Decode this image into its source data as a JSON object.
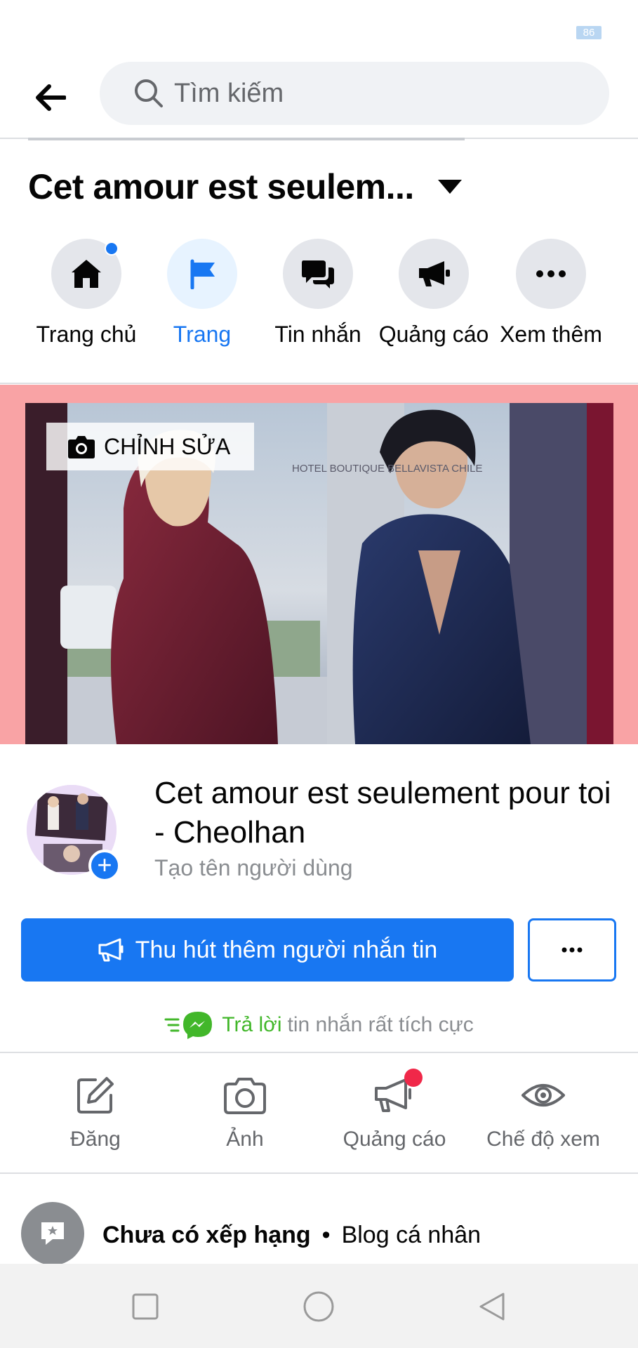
{
  "status_bar": {
    "battery": "86"
  },
  "search": {
    "placeholder": "Tìm kiếm"
  },
  "page": {
    "title": "Cet amour est seulem..."
  },
  "nav": {
    "items": [
      {
        "label": "Trang chủ",
        "icon": "home-icon",
        "active": false,
        "badge": true
      },
      {
        "label": "Trang",
        "icon": "flag-icon",
        "active": true,
        "badge": false
      },
      {
        "label": "Tin nhắn",
        "icon": "chat-icon",
        "active": false,
        "badge": false
      },
      {
        "label": "Quảng cáo",
        "icon": "megaphone-icon",
        "active": false,
        "badge": false
      },
      {
        "label": "Xem thêm",
        "icon": "more-icon",
        "active": false,
        "badge": false
      }
    ]
  },
  "cover": {
    "edit_label": "CHỈNH SỬA",
    "sign_text": "HOTEL BOUTIQUE BELLAVISTA CHILE"
  },
  "profile": {
    "name": "Cet amour est seulement pour toi - Cheolhan",
    "username_prompt": "Tạo tên người dùng"
  },
  "actions": {
    "primary_label": "Thu hút thêm người nhắn tin",
    "more_label": "•••"
  },
  "response": {
    "highlight": "Trả lời",
    "rest": "tin nhắn rất tích cực"
  },
  "bottom_actions": [
    {
      "label": "Đăng",
      "icon": "edit-icon"
    },
    {
      "label": "Ảnh",
      "icon": "camera-icon"
    },
    {
      "label": "Quảng cáo",
      "icon": "megaphone-icon",
      "badge": true
    },
    {
      "label": "Chế độ xem",
      "icon": "eye-icon"
    }
  ],
  "rating": {
    "rating_label": "Chưa có xếp hạng",
    "separator": "•",
    "category": "Blog cá nhân"
  },
  "colors": {
    "brand_blue": "#1877f2",
    "cover_bg": "#f9a3a5",
    "green": "#42b72a",
    "badge_red": "#f02849"
  }
}
